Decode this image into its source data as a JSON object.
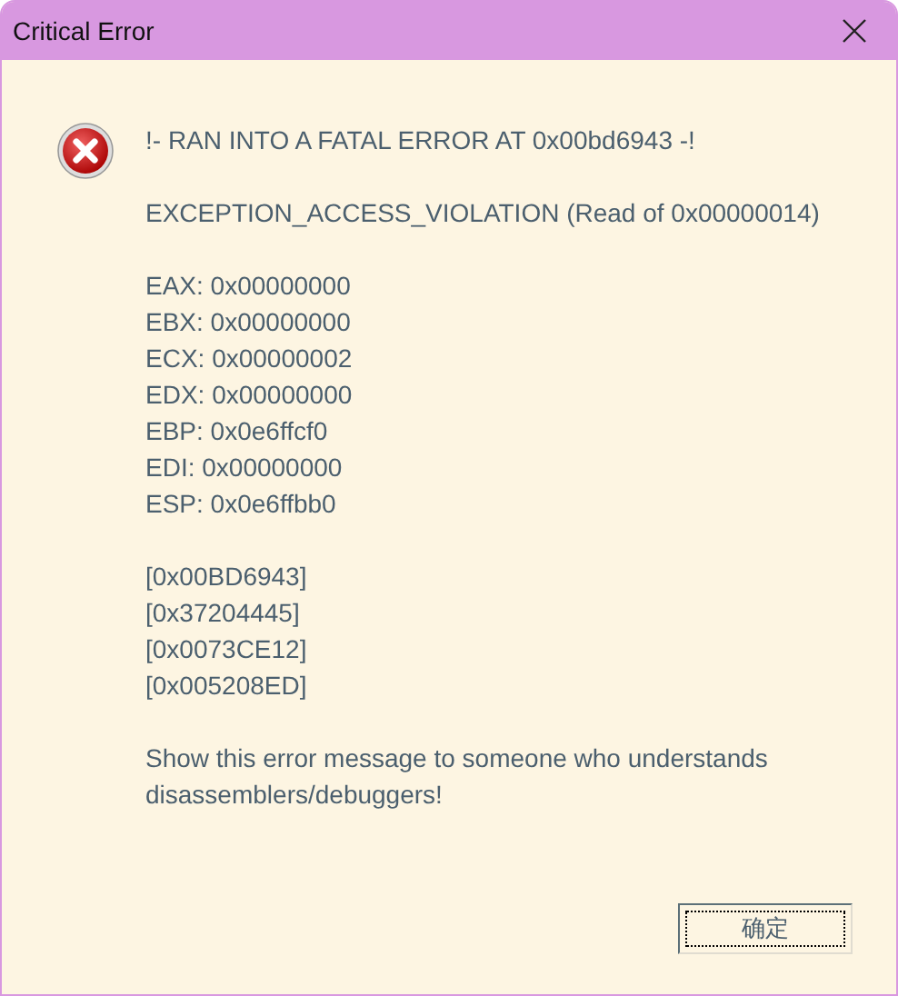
{
  "window": {
    "title": "Critical Error"
  },
  "message": {
    "heading": "!- RAN INTO A FATAL ERROR AT 0x00bd6943 -!",
    "exception": "EXCEPTION_ACCESS_VIOLATION (Read of 0x00000014)",
    "registers": [
      "EAX: 0x00000000",
      "EBX: 0x00000000",
      "ECX: 0x00000002",
      "EDX: 0x00000000",
      "EBP: 0x0e6ffcf0",
      "EDI: 0x00000000",
      "ESP: 0x0e6ffbb0"
    ],
    "stack": [
      "[0x00BD6943]",
      "[0x37204445]",
      "[0x0073CE12]",
      "[0x005208ED]"
    ],
    "advice": "Show this error message to someone who understands disassemblers/debuggers!"
  },
  "buttons": [
    {
      "label": "确定",
      "focused": true
    }
  ]
}
